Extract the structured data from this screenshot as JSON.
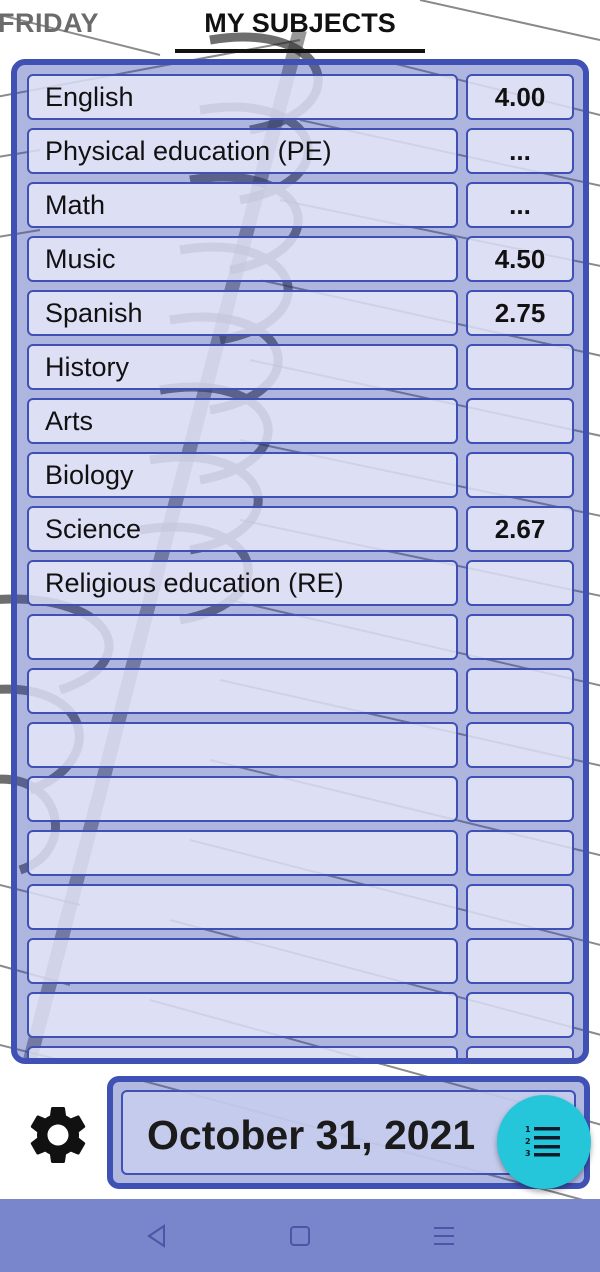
{
  "tabs": {
    "previous": "FRIDAY",
    "active": "MY SUBJECTS"
  },
  "subjects": [
    {
      "name": "English",
      "grade": "4.00"
    },
    {
      "name": "Physical education (PE)",
      "grade": "..."
    },
    {
      "name": "Math",
      "grade": "..."
    },
    {
      "name": "Music",
      "grade": "4.50"
    },
    {
      "name": "Spanish",
      "grade": "2.75"
    },
    {
      "name": "History",
      "grade": ""
    },
    {
      "name": "Arts",
      "grade": ""
    },
    {
      "name": "Biology",
      "grade": ""
    },
    {
      "name": "Science",
      "grade": "2.67"
    },
    {
      "name": "Religious education (RE)",
      "grade": ""
    },
    {
      "name": "",
      "grade": ""
    },
    {
      "name": "",
      "grade": ""
    },
    {
      "name": "",
      "grade": ""
    },
    {
      "name": "",
      "grade": ""
    },
    {
      "name": "",
      "grade": ""
    },
    {
      "name": "",
      "grade": ""
    },
    {
      "name": "",
      "grade": ""
    },
    {
      "name": "",
      "grade": ""
    },
    {
      "name": "",
      "grade": ""
    }
  ],
  "date": "October 31, 2021",
  "icons": {
    "settings": "gear-icon",
    "fab": "numbered-list-icon",
    "nav_back": "back-triangle-icon",
    "nav_home": "home-square-icon",
    "nav_menu": "menu-lines-icon"
  },
  "colors": {
    "accent": "#3f51b5",
    "fab": "#26c6da",
    "navbar": "#7986cb"
  }
}
